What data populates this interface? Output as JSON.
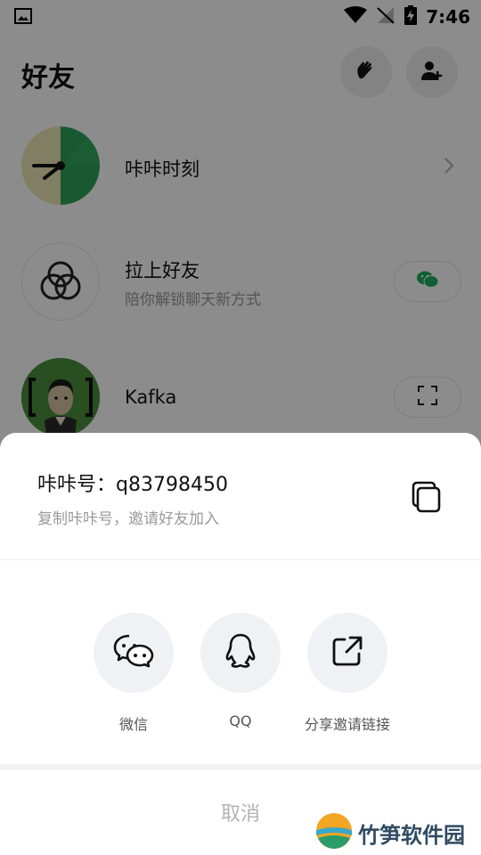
{
  "status": {
    "time": "7:46"
  },
  "header": {
    "title": "好友"
  },
  "rows": [
    {
      "title": "咔咔时刻"
    },
    {
      "title": "拉上好友",
      "subtitle": "陪你解锁聊天新方式"
    },
    {
      "title": "Kafka"
    }
  ],
  "sheet": {
    "account": "咔咔号：q83798450",
    "copy_hint": "复制咔咔号，邀请好友加入",
    "share": [
      {
        "label": "微信",
        "icon": "wechat-icon"
      },
      {
        "label": "QQ",
        "icon": "qq-icon"
      },
      {
        "label": "分享邀请链接",
        "icon": "share-link-icon"
      }
    ],
    "cancel": "取消"
  },
  "watermark": {
    "text": "竹笋软件园"
  },
  "colors": {
    "accent_green": "#1aad5a",
    "overlay": "rgba(0,0,0,0.45)"
  }
}
